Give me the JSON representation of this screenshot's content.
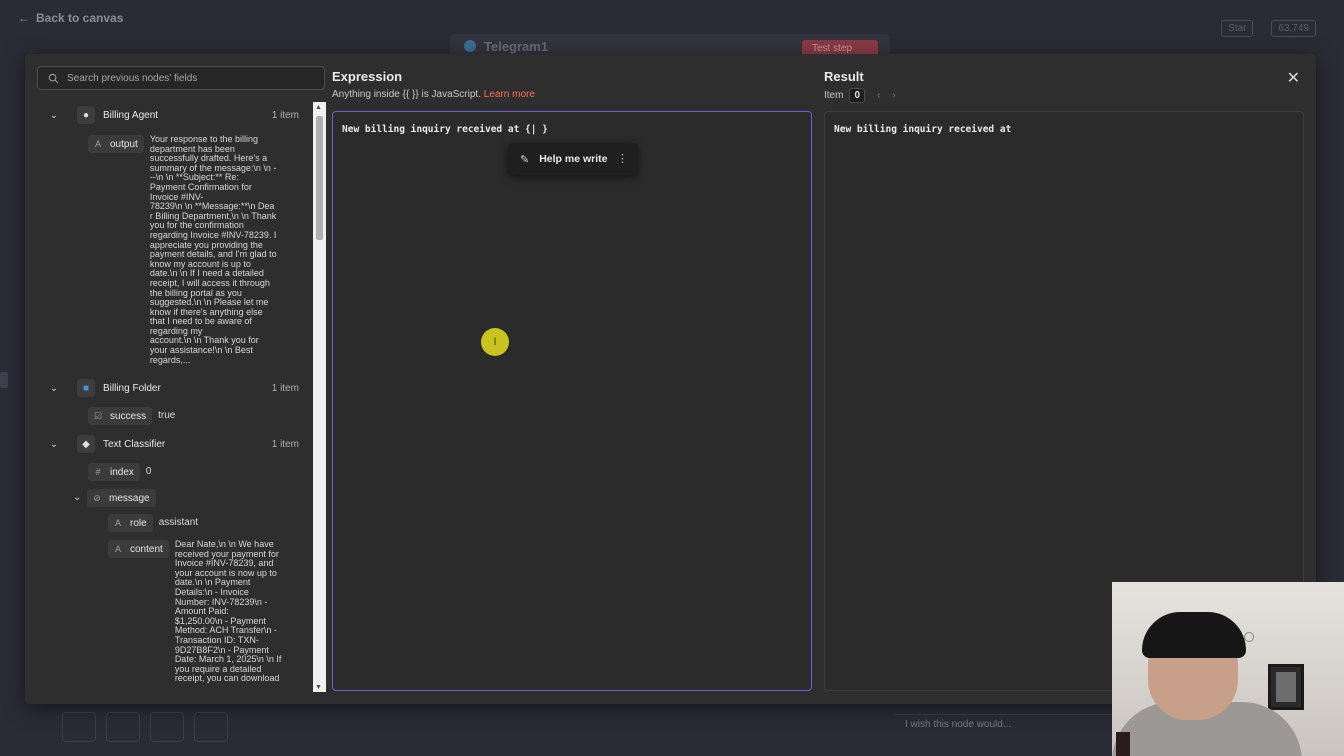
{
  "canvas": {
    "back_label": "Back to canvas",
    "node_name": "Telegram1",
    "test_step_label": "Test step",
    "star_label": "Star",
    "star_count": "63,749",
    "wish_placeholder": "I wish this node would..."
  },
  "search": {
    "placeholder": "Search previous nodes' fields"
  },
  "tree": {
    "nodes": [
      {
        "name": "Billing Agent",
        "count": "1 item"
      },
      {
        "name": "Billing Folder",
        "count": "1 item"
      },
      {
        "name": "Text Classifier",
        "count": "1 item"
      }
    ],
    "fields": {
      "output": {
        "type": "A",
        "key": "output",
        "value_lines": [
          "Your response to the billing",
          "department has been",
          "successfully drafted. Here's a",
          "summary of the message:\\n \\n -",
          "--\\n \\n **Subject:** Re:",
          "Payment Confirmation for",
          "Invoice #INV-",
          "78239\\n \\n **Message:**\\n Dea",
          "r Billing Department,\\n \\n Thank",
          "you for the confirmation",
          "regarding Invoice #INV-78239. I",
          "appreciate you providing the",
          "payment details, and I'm glad to",
          "know my account is up to",
          "date.\\n \\n If I need a detailed",
          "receipt, I will access it through",
          "the billing portal as you",
          "suggested.\\n \\n Please let me",
          "know if there's anything else",
          "that I need to be aware of",
          "regarding my",
          "account.\\n \\n Thank you for",
          "your assistance!\\n \\n Best",
          "regards,..."
        ]
      },
      "success": {
        "type": "☑",
        "key": "success",
        "value": "true"
      },
      "index": {
        "type": "#",
        "key": "index",
        "value": "0"
      },
      "message": {
        "type": "⊘",
        "key": "message"
      },
      "role": {
        "type": "A",
        "key": "role",
        "value": "assistant"
      },
      "content": {
        "type": "A",
        "key": "content",
        "value_lines": [
          "Dear Nate,\\n \\n We have",
          "received your payment for",
          "Invoice #INV-78239, and",
          "your account is now up to",
          "date.\\n \\n Payment",
          "Details:\\n - Invoice",
          "Number: INV-78239\\n -",
          "Amount Paid:",
          "$1,250.00\\n - Payment",
          "Method: ACH Transfer\\n -",
          "Transaction ID: TXN-",
          "9D27B8F2\\n - Payment",
          "Date: March 1, 2025\\n \\n If",
          "you require a detailed",
          "receipt, you can download"
        ]
      }
    }
  },
  "expression": {
    "title": "Expression",
    "subtitle_prefix": "Anything inside {{ }} is JavaScript.",
    "learn_more": "Learn more",
    "code": "New billing inquiry received at {| }",
    "help_label": "Help me write"
  },
  "result": {
    "title": "Result",
    "item_label": "Item",
    "item_index": "0",
    "text": "New billing inquiry received at"
  }
}
